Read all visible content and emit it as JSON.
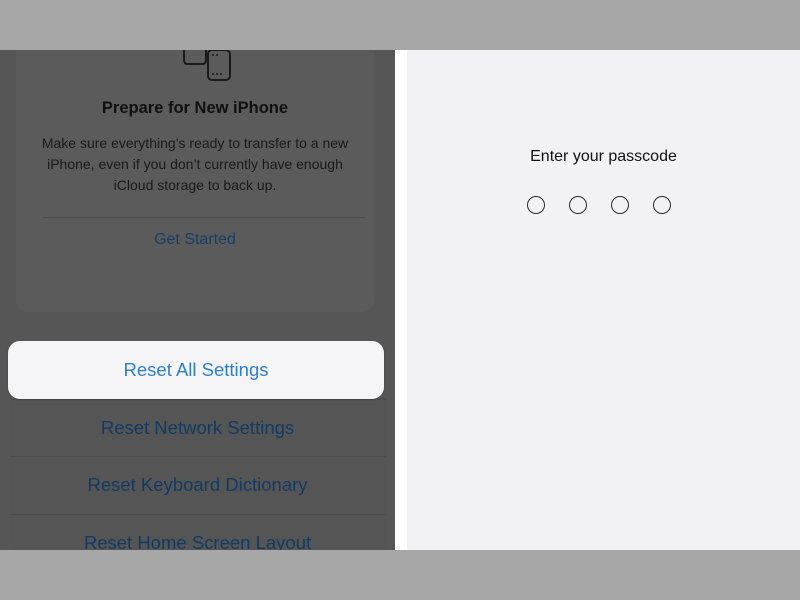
{
  "prepare_card": {
    "title": "Prepare for New iPhone",
    "description": "Make sure everything’s ready to transfer to a new iPhone, even if you don’t currently have enough iCloud storage to back up.",
    "get_started": "Get Started"
  },
  "reset_menu": {
    "selected": "Reset All Settings",
    "items": [
      "Reset All Settings",
      "Reset Network Settings",
      "Reset Keyboard Dictionary",
      "Reset Home Screen Layout"
    ]
  },
  "passcode": {
    "title": "Enter your passcode",
    "digit_count": 4,
    "entered": 0
  },
  "colors": {
    "ios_blue": "#2f7ec9",
    "dimmed_background": "#565656",
    "passcode_background": "#f1f1f6",
    "frame_gray": "#a7a7a7"
  }
}
